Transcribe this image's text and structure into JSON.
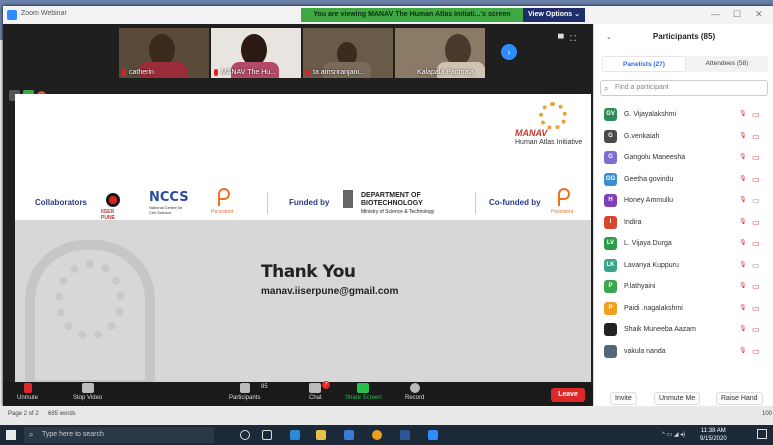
{
  "window": {
    "title": "Zoom Webinar",
    "banner": "You are viewing MANAV The Human Atlas Initiati...'s screen",
    "view_options": "View Options ⌄",
    "minimize": "—",
    "maximize": "☐",
    "close": "✕"
  },
  "video_strip": [
    {
      "name": "catherin",
      "muted": true
    },
    {
      "name": "MANAV The Hu...",
      "muted": true
    },
    {
      "name": "ta amsriranjani...",
      "muted": true
    },
    {
      "name": "Kalapala Padmaja",
      "muted": false
    }
  ],
  "slide": {
    "brand": "MANAV",
    "brand_sub": "Human Atlas Initiative",
    "collaborators_label": "Collaborators",
    "iiser": "IISER PUNE",
    "nccs": "NCCS",
    "nccs_sub": "National Centre for Cell Science",
    "persistent": "Persistent",
    "funded_by": "Funded by",
    "dbt_line1": "DEPARTMENT OF",
    "dbt_line2": "BIOTECHNOLOGY",
    "dbt_line3": "Ministry of Science & Technology",
    "cofunded_by": "Co-funded by",
    "persistent2": "Persistent",
    "thanks": "Thank You",
    "email": "manav.iiserpune@gmail.com"
  },
  "toolbar": {
    "unmute": "Unmute",
    "stop_video": "Stop Video",
    "participants": "Participants",
    "participants_count": "85",
    "chat": "Chat",
    "chat_badge": "7",
    "share_screen": "Share Screen",
    "record": "Record",
    "leave": "Leave"
  },
  "panel": {
    "title": "Participants (85)",
    "tabs": [
      "Panelists (27)",
      "Attendees (58)"
    ],
    "search_placeholder": "Find a participant",
    "participants": [
      {
        "initials": "GV",
        "name": "G. Vijayalakshmi",
        "color": "#2e8b57",
        "cam_off": false
      },
      {
        "initials": "G",
        "name": "G.venkaiah",
        "color": "#4a4a4a",
        "cam_off": false
      },
      {
        "initials": "G",
        "name": "Gangolu Maneesha",
        "color": "#7b6fd6",
        "cam_off": false
      },
      {
        "initials": "GG",
        "name": "Geetha govindu",
        "color": "#3a8fd0",
        "cam_off": false
      },
      {
        "initials": "H",
        "name": "Honey Ammullu",
        "color": "#7e3fb8",
        "cam_off": true
      },
      {
        "initials": "I",
        "name": "Indira",
        "color": "#d9442a",
        "cam_off": false
      },
      {
        "initials": "LV",
        "name": "L. Vijaya Durga",
        "color": "#2f9a4a",
        "cam_off": false
      },
      {
        "initials": "LK",
        "name": "Lavanya Kuppuru",
        "color": "#3aa38a",
        "cam_off": true
      },
      {
        "initials": "P",
        "name": "P.lathyaini",
        "color": "#3aa84a",
        "cam_off": false
      },
      {
        "initials": "P",
        "name": "Paidi .nagalakshmi",
        "color": "#f0a020",
        "cam_off": false
      },
      {
        "initials": "",
        "name": "Shaik Muneeba Aazam",
        "color": "#222222",
        "cam_off": false
      },
      {
        "initials": "",
        "name": "vakula nanda",
        "color": "#556677",
        "cam_off": false
      }
    ],
    "invite": "Invite",
    "unmute_me": "Unmute Me",
    "raise_hand": "Raise Hand"
  },
  "status_bar": {
    "page": "Page 2 of 2",
    "words": "685 words",
    "zoom": "100"
  },
  "taskbar": {
    "search_placeholder": "Type here to search",
    "time": "11:38 AM",
    "date": "9/15/2020"
  }
}
